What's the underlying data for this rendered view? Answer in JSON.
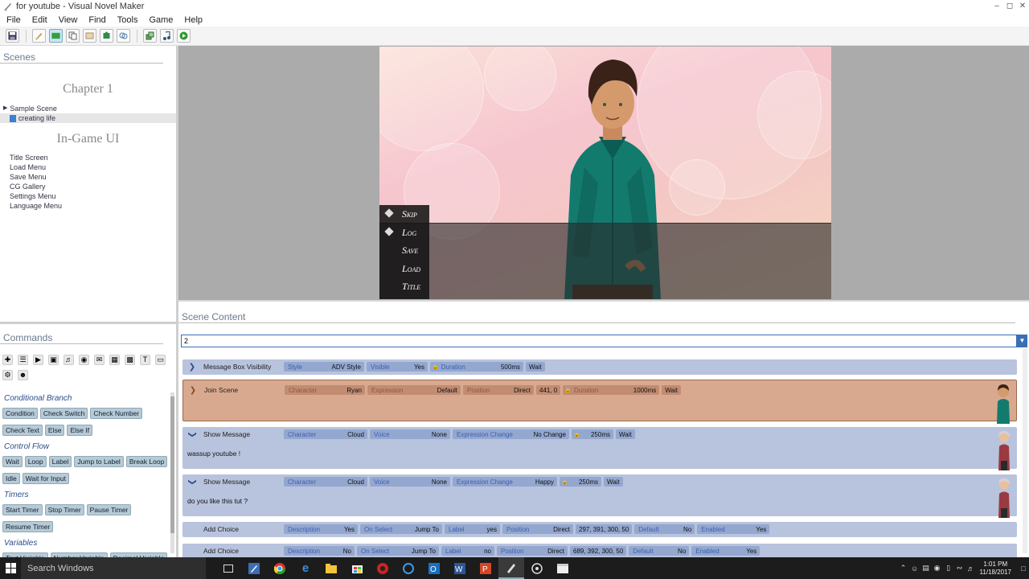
{
  "window": {
    "title": "for youtube - Visual Novel Maker"
  },
  "menubar": [
    "File",
    "Edit",
    "View",
    "Find",
    "Tools",
    "Game",
    "Help"
  ],
  "scenes_panel": {
    "header": "Scenes",
    "chapter_title": "Chapter 1",
    "scenes": [
      "Sample Scene",
      "creating life"
    ],
    "ui_title": "In-Game UI",
    "ui_items": [
      "Title Screen",
      "Load Menu",
      "Save Menu",
      "CG Gallery",
      "Settings Menu",
      "Language Menu"
    ]
  },
  "game_menu": [
    "Skip",
    "Log",
    "Save",
    "Load",
    "Title"
  ],
  "commands_panel": {
    "header": "Commands",
    "groups": [
      {
        "name": "Conditional Branch",
        "buttons": [
          "Condition",
          "Check Switch",
          "Check Number",
          "Check Text",
          "Else",
          "Else If"
        ]
      },
      {
        "name": "Control Flow",
        "buttons": [
          "Wait",
          "Loop",
          "Label",
          "Jump to Label",
          "Break Loop",
          "Idle",
          "Wait for Input"
        ]
      },
      {
        "name": "Timers",
        "buttons": [
          "Start Timer",
          "Stop Timer",
          "Pause Timer",
          "Resume Timer"
        ]
      },
      {
        "name": "Variables",
        "buttons": [
          "Text Variable",
          "Number Variable",
          "Decimal Variable"
        ]
      }
    ]
  },
  "scene_content": {
    "header": "Scene Content",
    "search_value": "2",
    "rows": [
      {
        "name": "Message Box Visibility",
        "chips": [
          [
            "Style",
            "ADV Style"
          ],
          [
            "Visible",
            "Yes"
          ],
          [
            "Duration",
            "500ms"
          ],
          [
            "",
            "Wait"
          ]
        ]
      },
      {
        "name": "Join Scene",
        "chips": [
          [
            "Character",
            "Ryan"
          ],
          [
            "Expression",
            "Default"
          ],
          [
            "Position",
            "Direct"
          ],
          [
            "",
            "441, 0"
          ],
          [
            "Duration",
            "1000ms"
          ],
          [
            "",
            "Wait"
          ]
        ]
      },
      {
        "name": "Show Message",
        "chips": [
          [
            "Character",
            "Cloud"
          ],
          [
            "Voice",
            "None"
          ],
          [
            "Expression Change",
            "No Change"
          ],
          [
            "",
            "250ms"
          ],
          [
            "",
            "Wait"
          ]
        ],
        "text": "wassup youtube !"
      },
      {
        "name": "Show Message",
        "chips": [
          [
            "Character",
            "Cloud"
          ],
          [
            "Voice",
            "None"
          ],
          [
            "Expression Change",
            "Happy"
          ],
          [
            "",
            "250ms"
          ],
          [
            "",
            "Wait"
          ]
        ],
        "text": "do you like this tut ?"
      },
      {
        "name": "Add Choice",
        "chips": [
          [
            "Description",
            "Yes"
          ],
          [
            "On Select",
            "Jump To"
          ],
          [
            "Label",
            "yes"
          ],
          [
            "Position",
            "Direct"
          ],
          [
            "",
            "297, 391, 300, 50"
          ],
          [
            "Default",
            "No"
          ],
          [
            "Enabled",
            "Yes"
          ]
        ]
      },
      {
        "name": "Add Choice",
        "chips": [
          [
            "Description",
            "No"
          ],
          [
            "On Select",
            "Jump To"
          ],
          [
            "Label",
            "no"
          ],
          [
            "Position",
            "Direct"
          ],
          [
            "",
            "689, 392, 300, 50"
          ],
          [
            "Default",
            "No"
          ],
          [
            "Enabled",
            "Yes"
          ]
        ]
      }
    ]
  },
  "taskbar": {
    "search_placeholder": "Search Windows",
    "time": "1:01 PM",
    "date": "11/18/2017"
  },
  "colors": {
    "accent": "#3a6fb5",
    "row_blue": "#b8c3dd",
    "row_orange": "#d9a98f",
    "cmd_button": "#b7cad6"
  }
}
